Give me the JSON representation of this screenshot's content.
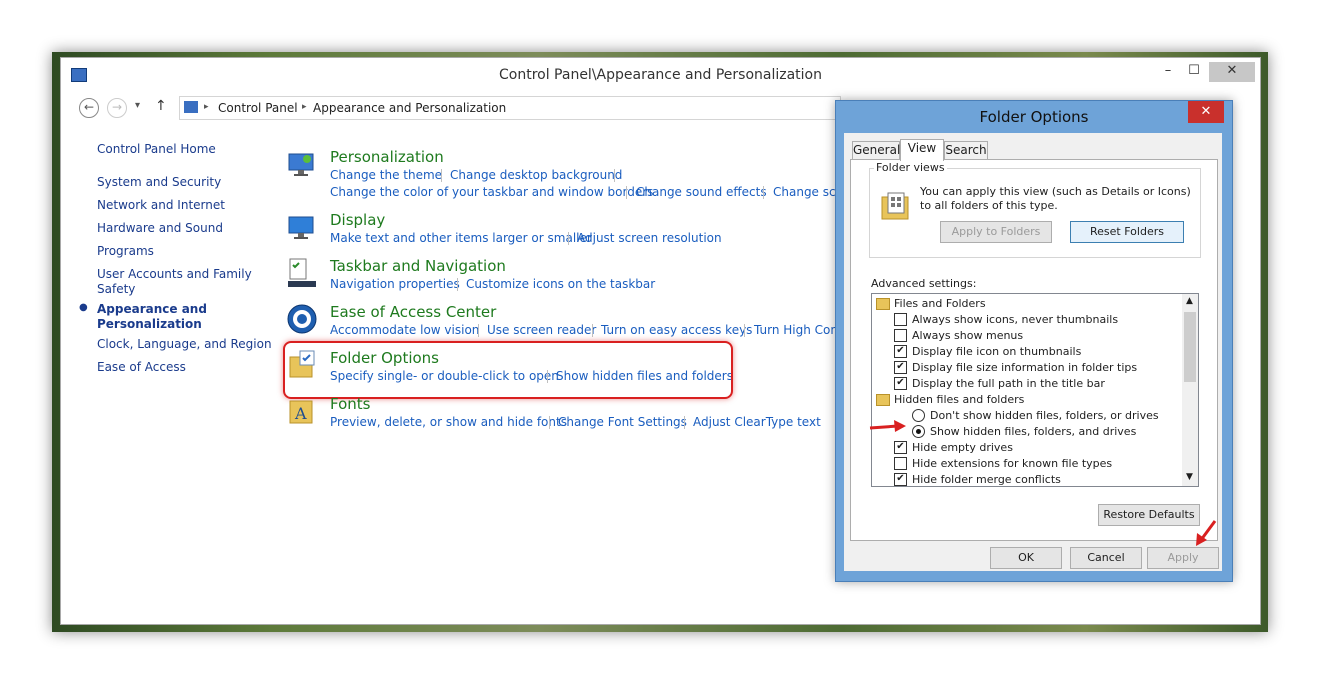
{
  "window": {
    "title": "Control Panel\\Appearance and Personalization"
  },
  "address": {
    "crumbs": [
      "Control Panel",
      "Appearance and Personalization"
    ]
  },
  "sidebar": {
    "items": [
      {
        "label": "Control Panel Home"
      },
      {
        "label": "System and Security"
      },
      {
        "label": "Network and Internet"
      },
      {
        "label": "Hardware and Sound"
      },
      {
        "label": "Programs"
      },
      {
        "label": "User Accounts and Family"
      },
      {
        "label": "Safety"
      },
      {
        "label": "Appearance and"
      },
      {
        "label": "Personalization"
      },
      {
        "label": "Clock, Language, and Region"
      },
      {
        "label": "Ease of Access"
      }
    ]
  },
  "categories": [
    {
      "title": "Personalization",
      "links": [
        "Change the theme",
        "Change desktop background",
        "Change the color of your taskbar and window borders",
        "Change sound effects",
        "Change scre"
      ]
    },
    {
      "title": "Display",
      "links": [
        "Make text and other items larger or smaller",
        "Adjust screen resolution"
      ]
    },
    {
      "title": "Taskbar and Navigation",
      "links": [
        "Navigation properties",
        "Customize icons on the taskbar"
      ]
    },
    {
      "title": "Ease of Access Center",
      "links": [
        "Accommodate low vision",
        "Use screen reader",
        "Turn on easy access keys",
        "Turn High Cont"
      ]
    },
    {
      "title": "Folder Options",
      "links": [
        "Specify single- or double-click to open",
        "Show hidden files and folders"
      ]
    },
    {
      "title": "Fonts",
      "links": [
        "Preview, delete, or show and hide fonts",
        "Change Font Settings",
        "Adjust ClearType text"
      ]
    }
  ],
  "dialog": {
    "title": "Folder Options",
    "tabs": [
      "General",
      "View",
      "Search"
    ],
    "folder_views": {
      "label": "Folder views",
      "text": "You can apply this view (such as Details or Icons) to all folders of this type.",
      "apply_label": "Apply to Folders",
      "reset_label": "Reset Folders"
    },
    "advanced_label": "Advanced settings:",
    "settings": [
      {
        "label": "Files and Folders",
        "kind": "folder",
        "checked": false
      },
      {
        "label": "Always show icons, never thumbnails",
        "kind": "checkbox",
        "checked": false
      },
      {
        "label": "Always show menus",
        "kind": "checkbox",
        "checked": false
      },
      {
        "label": "Display file icon on thumbnails",
        "kind": "checkbox",
        "checked": true
      },
      {
        "label": "Display file size information in folder tips",
        "kind": "checkbox",
        "checked": true
      },
      {
        "label": "Display the full path in the title bar",
        "kind": "checkbox",
        "checked": true
      },
      {
        "label": "Hidden files and folders",
        "kind": "folder",
        "checked": false
      },
      {
        "label": "Don't show hidden files, folders, or drives",
        "kind": "radio",
        "checked": false
      },
      {
        "label": "Show hidden files, folders, and drives",
        "kind": "radio",
        "checked": true
      },
      {
        "label": "Hide empty drives",
        "kind": "checkbox",
        "checked": true
      },
      {
        "label": "Hide extensions for known file types",
        "kind": "checkbox",
        "checked": false
      },
      {
        "label": "Hide folder merge conflicts",
        "kind": "checkbox",
        "checked": true
      }
    ],
    "restore_label": "Restore Defaults",
    "ok_label": "OK",
    "cancel_label": "Cancel",
    "apply_label": "Apply"
  },
  "colors": {
    "accent_red": "#d92020",
    "link": "#1a5dbf",
    "category": "#1e7a1e"
  }
}
